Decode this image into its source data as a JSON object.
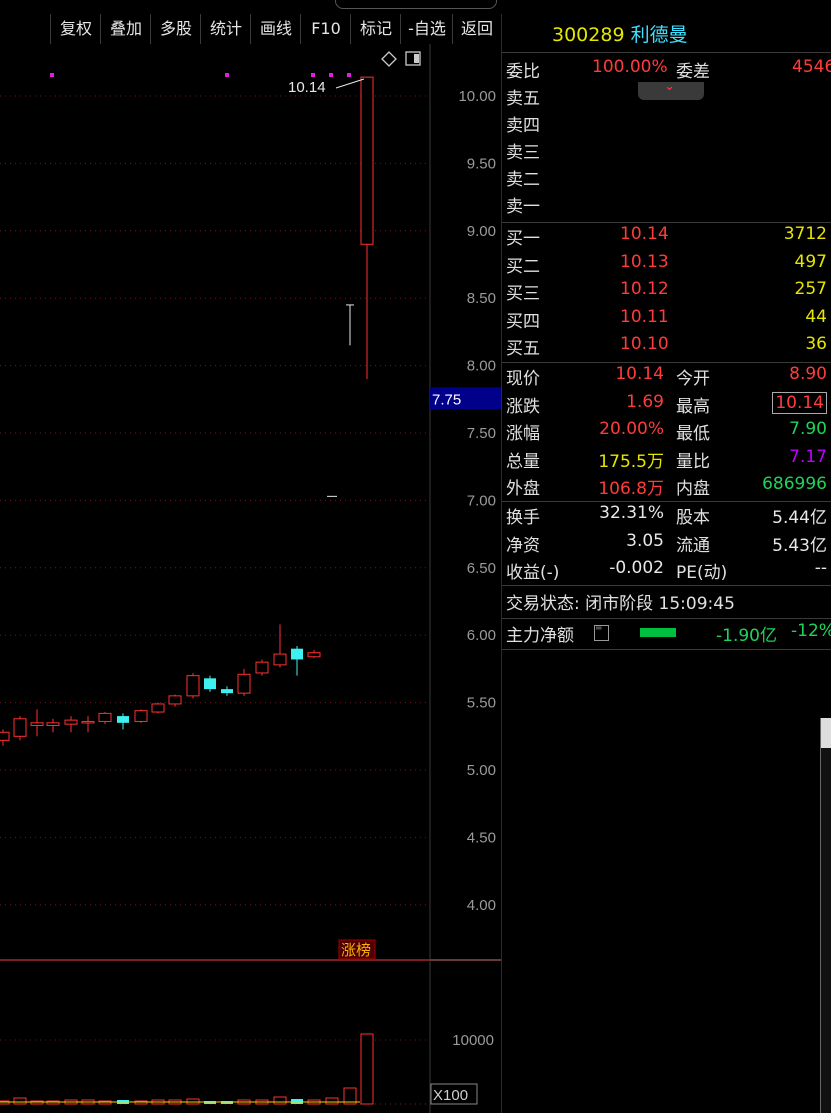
{
  "toolbar": {
    "buttons": [
      {
        "label": "复权"
      },
      {
        "label": "叠加"
      },
      {
        "label": "多股"
      },
      {
        "label": "统计"
      },
      {
        "label": "画线"
      },
      {
        "label": "F10"
      },
      {
        "label": "标记"
      },
      {
        "label": "-自选"
      },
      {
        "label": "返回"
      }
    ]
  },
  "chart": {
    "price_ticks": [
      "10.00",
      "9.50",
      "9.00",
      "8.50",
      "8.00",
      "7.50",
      "7.00",
      "6.50",
      "6.00",
      "5.50",
      "5.00",
      "4.50",
      "4.00"
    ],
    "current_price_tag": "7.75",
    "high_annotation": "10.14",
    "badge": "涨榜",
    "volume_tick": "10000",
    "volume_unit": "X100",
    "colors": {
      "up": "#ff3030",
      "down": "#3ff0f0",
      "grid": "#6e1a1a",
      "tag_bg": "#00008b"
    }
  },
  "quote": {
    "code": "300289",
    "name": "利德曼",
    "weibi_label": "委比",
    "weibi_value": "100.00%",
    "weicha_label": "委差",
    "weicha_value": "4546",
    "sell": [
      {
        "label": "卖五"
      },
      {
        "label": "卖四"
      },
      {
        "label": "卖三"
      },
      {
        "label": "卖二"
      },
      {
        "label": "卖一"
      }
    ],
    "buy": [
      {
        "label": "买一",
        "price": "10.14",
        "volume": "3712"
      },
      {
        "label": "买二",
        "price": "10.13",
        "volume": "497"
      },
      {
        "label": "买三",
        "price": "10.12",
        "volume": "257"
      },
      {
        "label": "买四",
        "price": "10.11",
        "volume": "44"
      },
      {
        "label": "买五",
        "price": "10.10",
        "volume": "36"
      }
    ],
    "stats": [
      {
        "l1": "现价",
        "v1": "10.14",
        "l2": "今开",
        "v2": "8.90"
      },
      {
        "l1": "涨跌",
        "v1": "1.69",
        "l2": "最高",
        "v2": "10.14"
      },
      {
        "l1": "涨幅",
        "v1": "20.00%",
        "l2": "最低",
        "v2": "7.90"
      },
      {
        "l1": "总量",
        "v1": "175.5万",
        "l2": "量比",
        "v2": "7.17"
      },
      {
        "l1": "外盘",
        "v1": "106.8万",
        "l2": "内盘",
        "v2": "686996"
      }
    ],
    "fundamentals": [
      {
        "l1": "换手",
        "v1": "32.31%",
        "l2": "股本",
        "v2": "5.44亿"
      },
      {
        "l1": "净资",
        "v1": "3.05",
        "l2": "流通",
        "v2": "5.43亿"
      },
      {
        "l1": "收益(-)",
        "v1": "-0.002",
        "l2": "PE(动)",
        "v2": "--"
      }
    ],
    "trade_status": "交易状态: 闭市阶段 15:09:45",
    "main_flow_label": "主力净额",
    "main_flow_value": "-1.90亿",
    "main_flow_pct": "-12%"
  }
}
